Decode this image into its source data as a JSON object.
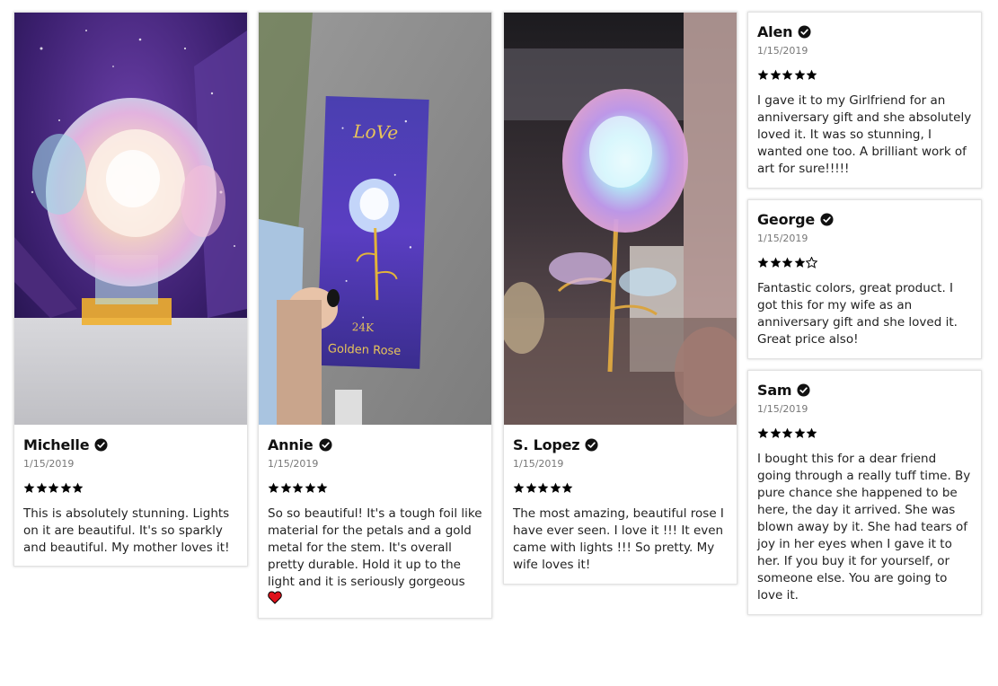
{
  "reviews": [
    {
      "name": "Michelle",
      "date": "1/15/2019",
      "rating": 5,
      "text": "This is absolutely stunning. Lights on it are beautiful. It's so sparkly and beautiful. My mother loves it!",
      "photo_icon": "iridescent-rose-photo"
    },
    {
      "name": "Annie",
      "date": "1/15/2019",
      "rating": 5,
      "text": "So so beautiful! It's a tough foil like material for the petals and a gold metal for the stem. It's overall pretty durable. Hold it up to the light and it is seriously gorgeous",
      "emoji": "heart-icon",
      "photo_icon": "golden-rose-box-photo",
      "box_text": {
        "brand": "LoVe",
        "size": "24K",
        "product": "Golden Rose"
      }
    },
    {
      "name": "S. Lopez",
      "date": "1/15/2019",
      "rating": 5,
      "text": "The most amazing, beautiful rose I have ever seen. I love it !!! It even came with lights !!! So pretty. My wife loves it!",
      "photo_icon": "rainbow-rose-photo"
    },
    {
      "name": "Alen",
      "date": "1/15/2019",
      "rating": 5,
      "text": "I gave it to my Girlfriend for an anniversary gift and she absolutely loved it. It was so stunning, I wanted one too. A brilliant work of art for sure!!!!!"
    },
    {
      "name": "George",
      "date": "1/15/2019",
      "rating": 4,
      "text": "Fantastic colors, great product. I got this for my wife as an anniversary gift and she loved it. Great price also!"
    },
    {
      "name": "Sam",
      "date": "1/15/2019",
      "rating": 5,
      "text": "I bought this for a dear friend going through a really tuff time. By pure chance she happened to be here, the day it arrived. She was blown away by it. She had tears of joy in her eyes when I gave it to her. If you buy it for yourself, or someone else. You are going to love it."
    }
  ],
  "colors": {
    "star": "#000000",
    "verified_badge": "#111111",
    "heart": "#e0121b"
  },
  "icons": {
    "verified": "check-circle-icon",
    "star": "star-icon"
  }
}
